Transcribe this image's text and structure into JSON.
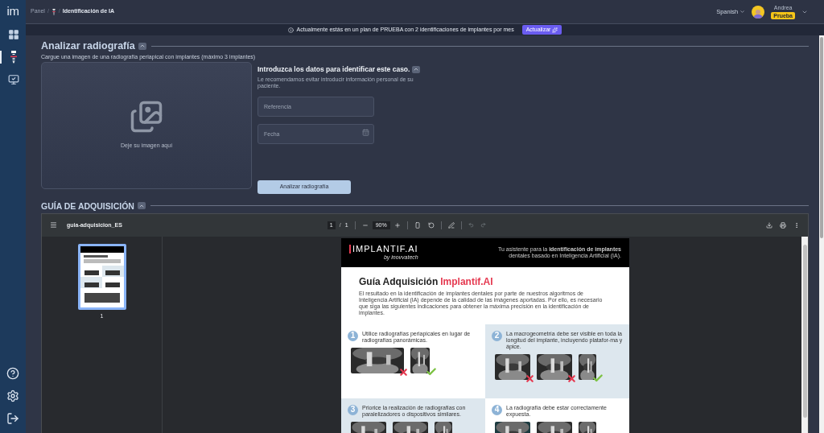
{
  "sidebar": {
    "logo": "im",
    "items": [
      {
        "kind": "dashboard",
        "selected": false
      },
      {
        "kind": "implant",
        "selected": true
      },
      {
        "kind": "checklist",
        "selected": false
      }
    ],
    "bottom_items": [
      {
        "kind": "help"
      },
      {
        "kind": "settings"
      },
      {
        "kind": "logout"
      }
    ]
  },
  "header": {
    "breadcrumb": [
      "Panel",
      "Identificación de IA"
    ],
    "breadcrumb_separator": "/",
    "language": "Spanish",
    "user": {
      "name": "Andrea",
      "plan_badge": "Prueba"
    }
  },
  "banner": {
    "text": "Actualmente estás en un plan de PRUEBA con 2 identificaciones de implantes por mes",
    "button": "Actualizar"
  },
  "analyze": {
    "title": "Analizar radiografía",
    "subtitle": "Cargue una imagen de una radiografía periapical con implantes (máximo 3 implantes)",
    "dropzone": "Deje su imagen aquí",
    "form_title": "Introduzca los datos para identificar este caso.",
    "form_note": "Le recomendamos evitar introducir información personal de su paciente.",
    "fields": [
      {
        "kind": "text",
        "placeholder": "Referencia"
      },
      {
        "kind": "date",
        "placeholder": "Fecha"
      }
    ],
    "button": "Analizar radiografía"
  },
  "guide": {
    "title": "GUÍA DE ADQUISICIÓN",
    "viewer": {
      "filename": "guia-adquisicion_ES",
      "page": "1",
      "page_separator": "/",
      "page_total": "1",
      "zoom": "90%",
      "thumbnails": [
        {
          "label": "1",
          "selected": true
        }
      ],
      "document": {
        "logo": "IMPLANTIF.AI",
        "logo_byline": "by inovvatech",
        "tagline": "Tu asistente para la **identificación de implantes** dentales basado en Inteligencia Artificial (IA).",
        "title": "Guía Adquisición",
        "title_brand": "Implantif.AI",
        "intro": "El resultado en la identificación de implantes dentales por parte de nuestros algoritmos de Inteligencia Artificial (IA) depende de la calidad de las imágenes aportadas. Por ello, es necesario que siga las siguientes indicaciones para obtener la máxima precisión en la identificación de implantes.",
        "steps": [
          {
            "number": "1",
            "text": "Utilice radiografías periapicales en lugar de radiografías panorámicas.",
            "highlighted": false,
            "images": [
              {
                "kind": "picture",
                "correct": false
              },
              {
                "kind": "picture",
                "correct": true
              }
            ]
          },
          {
            "number": "2",
            "text": "La macrogeometría debe ser visible en toda la longitud del implante, incluyendo platafor-ma y ápice.",
            "highlighted": true,
            "images": [
              {
                "kind": "picture",
                "correct": false
              },
              {
                "kind": "picture",
                "correct": false
              },
              {
                "kind": "picture",
                "correct": true
              }
            ]
          },
          {
            "number": "3",
            "text": "Priorice la realización de radiografías con paralelizadores o dispositivos similares.",
            "highlighted": true,
            "images": [
              {
                "kind": "picture"
              },
              {
                "kind": "picture"
              },
              {
                "kind": "picture"
              }
            ]
          },
          {
            "number": "4",
            "text": "La radiografía debe estar correctamente expuesta.",
            "highlighted": false,
            "images": [
              {
                "kind": "picture"
              },
              {
                "kind": "picture"
              },
              {
                "kind": "picture"
              }
            ]
          }
        ]
      }
    }
  }
}
